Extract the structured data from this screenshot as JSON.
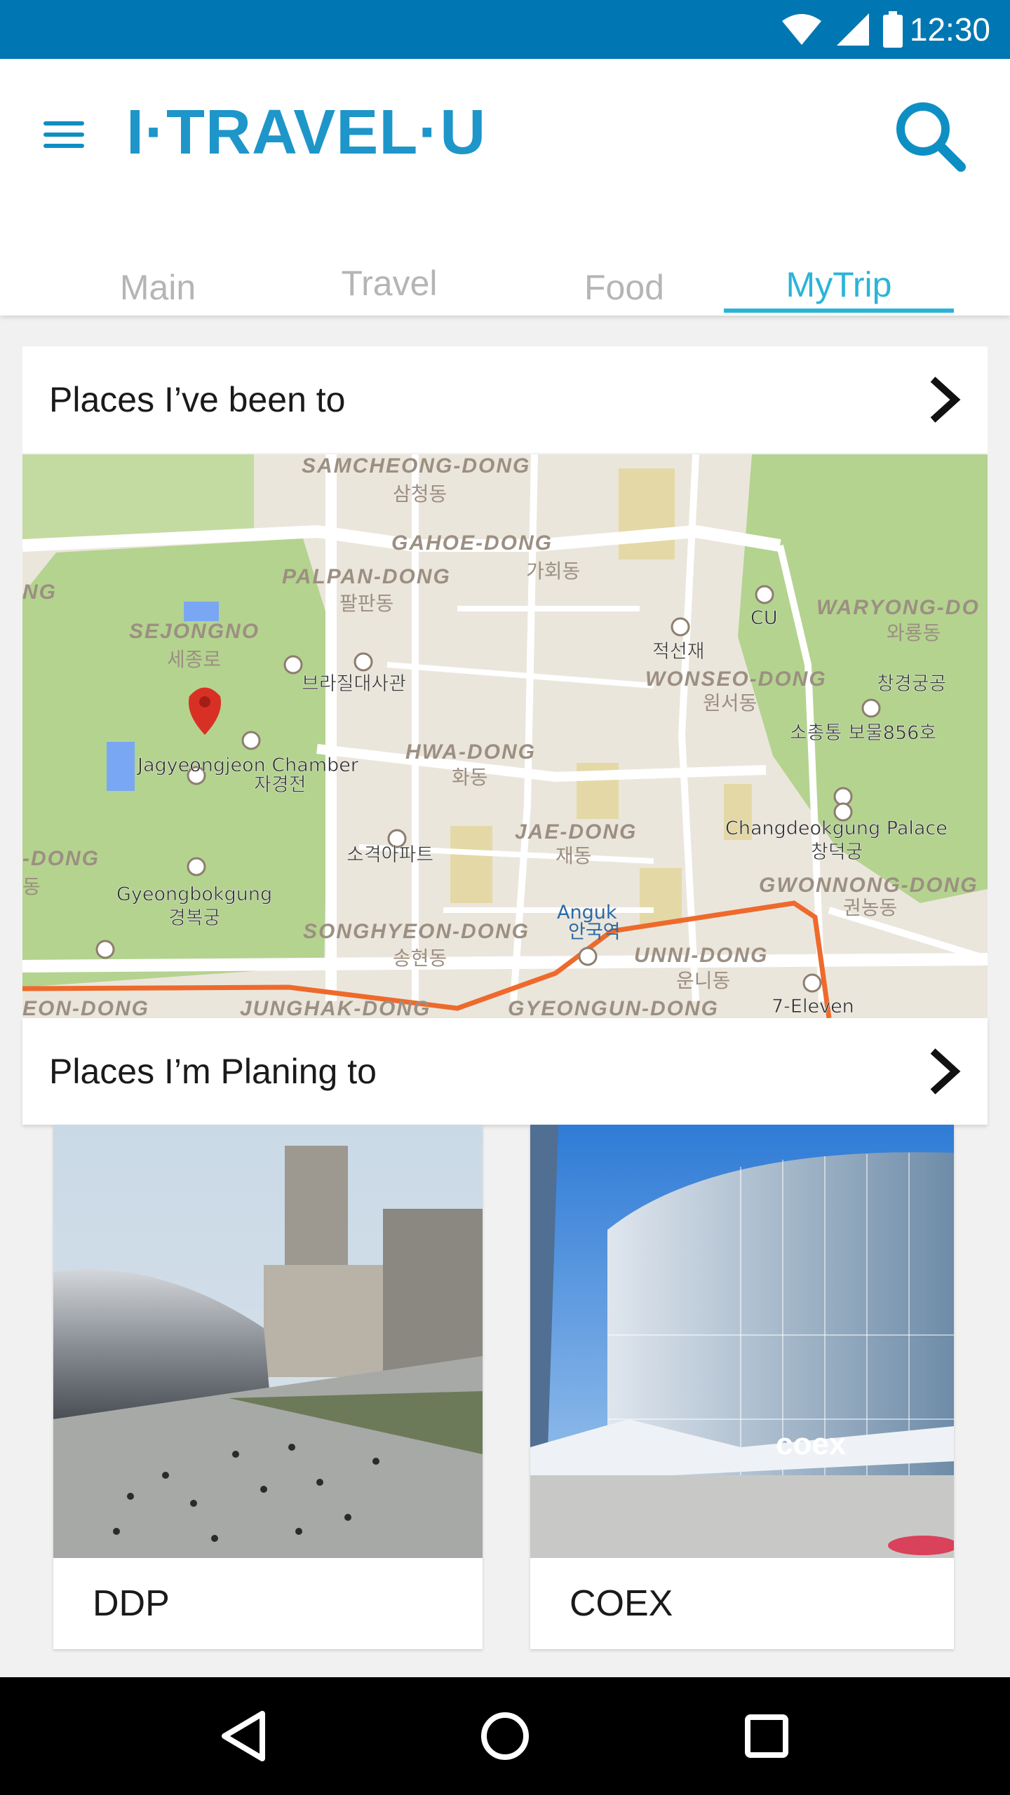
{
  "status_bar": {
    "time": "12:30",
    "icons": [
      "wifi-icon",
      "signal-icon",
      "battery-icon"
    ]
  },
  "app": {
    "logo": "I·TRAVEL·U",
    "menu_icon": "hamburger-icon",
    "search_icon": "search-icon"
  },
  "tabs": [
    {
      "label": "Main",
      "active": false
    },
    {
      "label": "Travel",
      "active": false
    },
    {
      "label": "Food",
      "active": false
    },
    {
      "label": "MyTrip",
      "active": true
    }
  ],
  "sections": {
    "been_to": {
      "label": "Places I’ve been to",
      "chevron": "chevron-right-icon"
    },
    "planning": {
      "label": "Places I’m Planing to",
      "chevron": "chevron-right-icon"
    }
  },
  "map": {
    "labels": {
      "samcheong": "SAMCHEONG-DONG",
      "samcheong_kr": "삼청동",
      "gahoe": "GAHOE-DONG",
      "gahoe_kr": "가회동",
      "palpan": "PALPAN-DONG",
      "palpan_kr": "팔판동",
      "sejongno": "SEJONGNO",
      "sejongno_kr": "세종로",
      "brazil": "브라질대사관",
      "cu": "CU",
      "jeokseonjae": "적선재",
      "waryong": "WARYONG-DO",
      "waryong_kr": "와룡동",
      "wonseo": "WONSEO-DONG",
      "wonseo_kr": "원서동",
      "changgyeong": "창경궁공",
      "sochongtong": "소총통 보물856호",
      "jagyeongjeon": "Jagyeongjeon Chamber",
      "jagyeongjeon_kr": "자경전",
      "hwa": "HWA-DONG",
      "hwa_kr": "화동",
      "jae": "JAE-DONG",
      "jae_kr": "재동",
      "changdeokgung": "Changdeokgung Palace",
      "changdeokgung_kr": "창덕궁",
      "sogyeok": "소격아파트",
      "gyeongbokgung": "Gyeongbokgung",
      "gyeongbokgung_kr": "경복궁",
      "dong_left": "-DONG",
      "dong_left_kr": "동",
      "ng": "NG",
      "gwonnong": "GWONNONG-DONG",
      "gwonnong_kr": "권농동",
      "anguk": "Anguk",
      "anguk_kr": "안국역",
      "songhyeon": "SONGHYEON-DONG",
      "songhyeon_kr": "송현동",
      "unni": "UNNI-DONG",
      "unni_kr": "운니동",
      "seven": "7-Eleven",
      "bottom1": "EON-DONG",
      "bottom2": "JUNGHAK-DONG",
      "bottom3": "GYEONGUN-DONG"
    }
  },
  "planned": [
    {
      "name": "DDP"
    },
    {
      "name": "COEX",
      "sign": "coex"
    }
  ],
  "nav": [
    "back-icon",
    "home-icon",
    "recents-icon"
  ]
}
